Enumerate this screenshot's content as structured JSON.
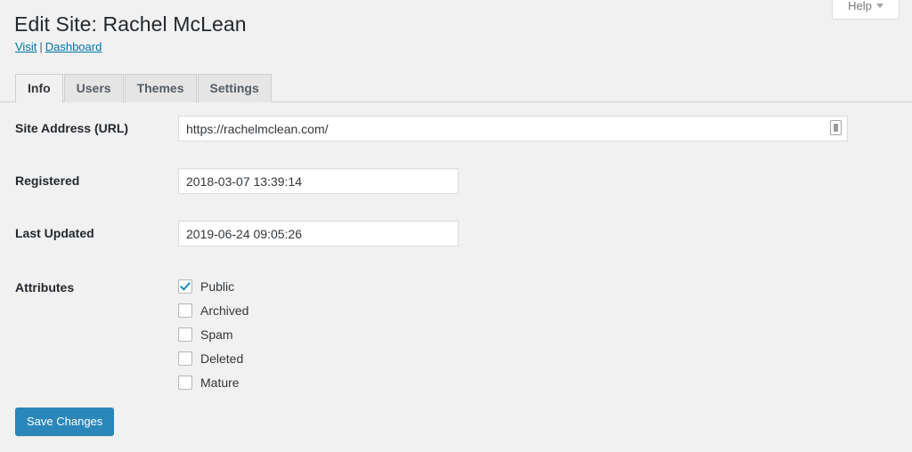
{
  "help": {
    "label": "Help",
    "icon": "chevron-down-icon"
  },
  "header": {
    "title": "Edit Site: Rachel McLean",
    "links": {
      "visit": "Visit",
      "separator": "|",
      "dashboard": "Dashboard"
    }
  },
  "tabs": [
    {
      "label": "Info",
      "active": true
    },
    {
      "label": "Users",
      "active": false
    },
    {
      "label": "Themes",
      "active": false
    },
    {
      "label": "Settings",
      "active": false
    }
  ],
  "fields": {
    "site_address": {
      "label": "Site Address (URL)",
      "value": "https://rachelmclean.com/",
      "icon": "autofill-icon"
    },
    "registered": {
      "label": "Registered",
      "value": "2018-03-07 13:39:14"
    },
    "last_updated": {
      "label": "Last Updated",
      "value": "2019-06-24 09:05:26"
    },
    "attributes": {
      "label": "Attributes",
      "items": [
        {
          "label": "Public",
          "checked": true
        },
        {
          "label": "Archived",
          "checked": false
        },
        {
          "label": "Spam",
          "checked": false
        },
        {
          "label": "Deleted",
          "checked": false
        },
        {
          "label": "Mature",
          "checked": false
        }
      ]
    }
  },
  "actions": {
    "save": "Save Changes"
  },
  "colors": {
    "background": "#f1f1f1",
    "link": "#0073aa",
    "primary_button": "#2b87ba",
    "checkbox_check": "#1e8cbe",
    "border": "#ccd0d4"
  }
}
